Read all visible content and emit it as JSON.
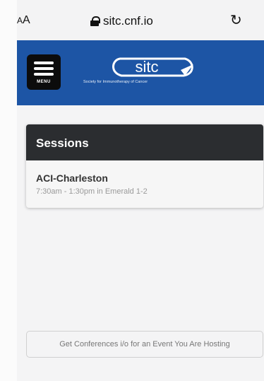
{
  "browser": {
    "text_size_label": "AA",
    "url": "sitc.cnf.io"
  },
  "header": {
    "menu_label": "MENU",
    "logo_text": "sitc",
    "tagline": "Society for Immunotherapy of Cancer",
    "brand_color": "#1d55a5"
  },
  "sessions": {
    "heading": "Sessions",
    "items": [
      {
        "title": "ACI-Charleston",
        "time": "7:30am - 1:30pm in Emerald 1-2"
      }
    ]
  },
  "footer": {
    "hosting_label": "Get Conferences i/o for an Event You Are Hosting"
  }
}
